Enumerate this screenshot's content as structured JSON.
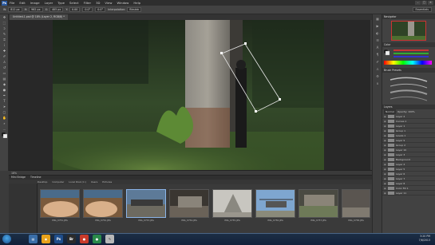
{
  "app": {
    "logo": "Ps",
    "menu": [
      "File",
      "Edit",
      "Image",
      "Layer",
      "Type",
      "Select",
      "Filter",
      "3D",
      "View",
      "Window",
      "Help"
    ],
    "window_controls": [
      "–",
      "□",
      "✕"
    ]
  },
  "options_bar": {
    "fields": [
      "W:",
      "812 px",
      "H:",
      "962 px",
      "X:",
      "405 px",
      "Y:",
      "0.00",
      "0.0°",
      "0.0°"
    ],
    "interpolation_label": "Interpolation:",
    "interpolation_value": "Bicubic",
    "workspace": "Essentials"
  },
  "document": {
    "tab_title": "Untitled-1.psd @ 18% (Layer 2, RGB/8) *",
    "status": "18%"
  },
  "panels": {
    "navigator_title": "Navigator",
    "color_title": "Color",
    "brush_title": "Brush Presets",
    "layers_title": "Layers",
    "blend_mode": "Normal",
    "opacity": "Opacity: 100%",
    "layers": [
      {
        "name": "Layer 2"
      },
      {
        "name": "Curves 1"
      },
      {
        "name": "Layer 1"
      },
      {
        "name": "Group 1"
      },
      {
        "name": "Levels 1"
      },
      {
        "name": "Layer 9"
      },
      {
        "name": "Group 2"
      },
      {
        "name": "Layer 10"
      },
      {
        "name": "Layer 3"
      },
      {
        "name": "Background"
      },
      {
        "name": "Layer 4"
      },
      {
        "name": "Layer 5"
      },
      {
        "name": "Layer 6"
      },
      {
        "name": "Layer 7"
      },
      {
        "name": "Layer 8"
      },
      {
        "name": "Color Fill 1"
      },
      {
        "name": "Layer 11"
      }
    ]
  },
  "bridge": {
    "tabs": [
      "Mini Bridge",
      "Timeline"
    ],
    "path": [
      "Desktop",
      "Computer",
      "Local Disk (C:)",
      "Users",
      "Pictures"
    ],
    "thumbnails": [
      {
        "caption": "IMG_0751.JPG"
      },
      {
        "caption": "IMG_0752.JPG"
      },
      {
        "caption": "IMG_0753.JPG"
      },
      {
        "caption": "IMG_0754.JPG"
      },
      {
        "caption": "IMG_0755.JPG"
      },
      {
        "caption": "IMG_0756.JPG"
      },
      {
        "caption": "IMG_0757.JPG"
      },
      {
        "caption": "IMG_0758.JPG"
      }
    ]
  },
  "taskbar": {
    "time": "3:20 PM",
    "date": "7/6/2013"
  }
}
